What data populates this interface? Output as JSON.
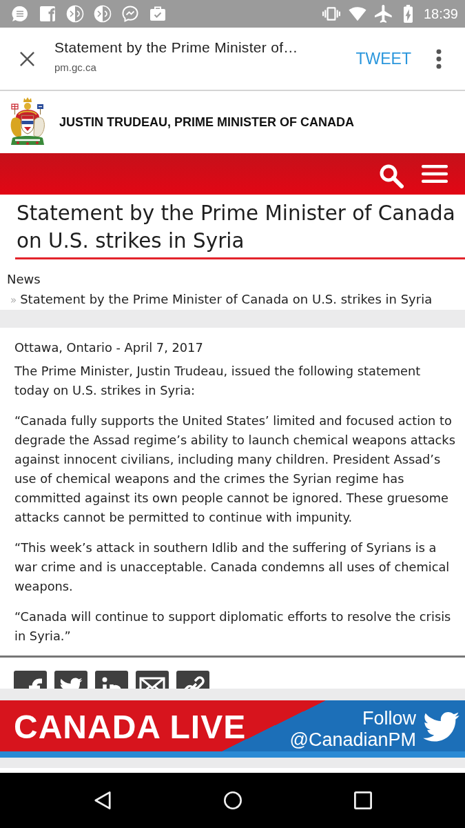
{
  "status_bar": {
    "time": "18:39"
  },
  "toolbar": {
    "title": "Statement by the Prime Minister of…",
    "url": "pm.gc.ca",
    "action": "TWEET"
  },
  "site_header": {
    "title": "JUSTIN TRUDEAU, PRIME MINISTER OF CANADA"
  },
  "article": {
    "title": "Statement by the Prime Minister of Canada on U.S. strikes in Syria"
  },
  "breadcrumb": {
    "root": "News",
    "separator": "»",
    "current": "Statement by the Prime Minister of Canada on U.S. strikes in Syria"
  },
  "body": {
    "dateline": "Ottawa, Ontario - April 7, 2017",
    "paragraphs": [
      "The Prime Minister, Justin Trudeau, issued the following statement today on U.S. strikes in Syria:",
      "“Canada fully supports the United States’ limited and focused action to degrade the Assad regime’s ability to launch chemical weapons attacks against innocent civilians, including many children. President Assad’s use of chemical weapons and the crimes the Syrian regime has committed against its own people cannot be ignored. These gruesome attacks cannot be permitted to continue with impunity.",
      "“This week’s attack in southern Idlib and the suffering of Syrians is a war crime and is unacceptable. Canada condemns all uses of chemical weapons.",
      "“Canada will continue to support diplomatic efforts to resolve the crisis in Syria.”"
    ]
  },
  "banner": {
    "title": "CANADA LIVE",
    "follow": "Follow",
    "handle": "@CanadianPM"
  }
}
